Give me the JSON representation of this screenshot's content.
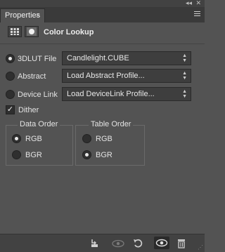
{
  "window": {
    "collapse_icon": "double-left-arrow-icon",
    "close_icon": "x-icon"
  },
  "panel": {
    "tab_label": "Properties",
    "tab_close": "×",
    "menu_icon": "panel-menu-icon"
  },
  "header": {
    "title": "Color Lookup",
    "icons": [
      "adjustment-icon",
      "mask-icon"
    ]
  },
  "rows": [
    {
      "label": "3DLUT File",
      "selected": true,
      "dropdown": "Candlelight.CUBE"
    },
    {
      "label": "Abstract",
      "selected": false,
      "dropdown": "Load Abstract Profile..."
    },
    {
      "label": "Device Link",
      "selected": false,
      "dropdown": "Load DeviceLink Profile..."
    }
  ],
  "dither": {
    "label": "Dither",
    "checked": true,
    "mark": "✓"
  },
  "data_order": {
    "title": "Data Order",
    "options": [
      {
        "label": "RGB",
        "selected": true
      },
      {
        "label": "BGR",
        "selected": false
      }
    ]
  },
  "table_order": {
    "title": "Table Order",
    "options": [
      {
        "label": "RGB",
        "selected": false
      },
      {
        "label": "BGR",
        "selected": true
      }
    ]
  },
  "bottom_bar": {
    "icons": [
      "clip-to-layer-icon",
      "view-previous-state-icon",
      "reset-icon",
      "visibility-eye-icon",
      "trash-icon"
    ]
  }
}
